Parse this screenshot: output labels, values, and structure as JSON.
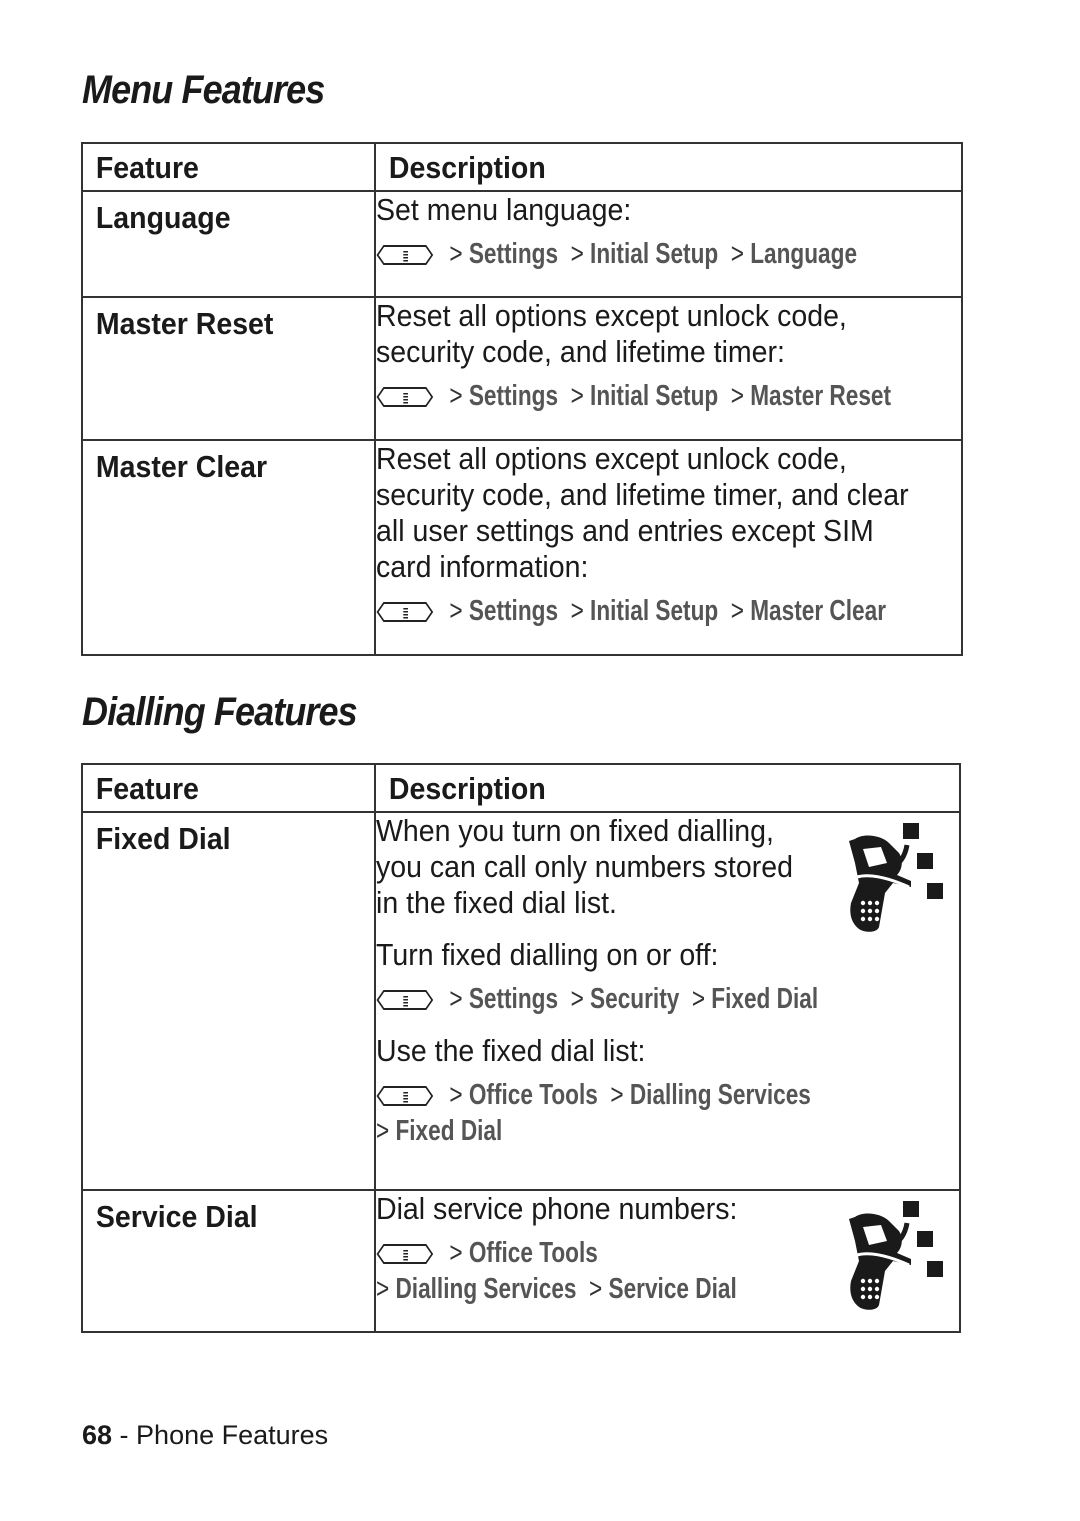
{
  "sections": [
    {
      "title": "Menu Features",
      "headers": {
        "feature": "Feature",
        "description": "Description"
      },
      "rows": [
        {
          "feature": "Language",
          "description": [
            "Set menu language:"
          ],
          "paths": [
            [
              "Settings",
              "Initial Setup",
              "Language"
            ]
          ]
        },
        {
          "feature": "Master Reset",
          "description": [
            "Reset all options except unlock code,",
            "security code, and lifetime timer:"
          ],
          "paths": [
            [
              "Settings",
              "Initial Setup",
              "Master Reset"
            ]
          ]
        },
        {
          "feature": "Master Clear",
          "description": [
            "Reset all options except unlock code,",
            "security code, and lifetime timer, and clear",
            "all user settings and entries except SIM",
            "card information:"
          ],
          "paths": [
            [
              "Settings",
              "Initial Setup",
              "Master Clear"
            ]
          ]
        }
      ]
    },
    {
      "title": "Dialling Features",
      "headers": {
        "feature": "Feature",
        "description": "Description"
      },
      "rows": [
        {
          "feature": "Fixed Dial",
          "icon": "network-phone-icon",
          "description": [
            "When you turn on fixed dialling,",
            "you can call only numbers stored",
            "in the fixed dial list."
          ],
          "sub1": "Turn fixed dialling on or off:",
          "path1": [
            "Settings",
            "Security",
            "Fixed Dial"
          ],
          "sub2": "Use the fixed dial list:",
          "path2a": [
            "Office Tools",
            "Dialling Services"
          ],
          "path2b": [
            "Fixed Dial"
          ]
        },
        {
          "feature": "Service Dial",
          "icon": "network-phone-icon",
          "description": [
            "Dial service phone numbers:"
          ],
          "path_a": [
            "Office Tools"
          ],
          "path_b": [
            "Dialling Services",
            "Service Dial"
          ]
        }
      ]
    }
  ],
  "separator": ">",
  "menu_key_icon": "menu-key-icon",
  "footer": {
    "page_number": "68",
    "dash": " - ",
    "section": "Phone Features"
  }
}
